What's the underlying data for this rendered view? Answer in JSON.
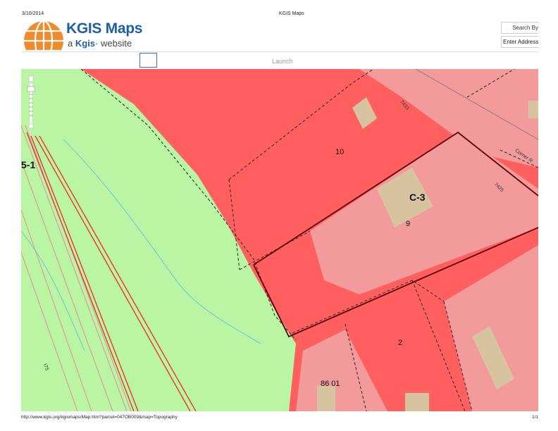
{
  "print_header": {
    "date": "3/10/2014",
    "title": "KGIS Maps"
  },
  "logo": {
    "title": "KGIS Maps",
    "sub_prefix": "a",
    "sub_brand": "Kgis",
    "sub_suffix": "website"
  },
  "search": {
    "by_label": "Search By",
    "address_value": "Enter Address"
  },
  "launch": {
    "label": "Launch"
  },
  "map": {
    "parcels": {
      "p10": "10",
      "p9": "9",
      "p2": "2",
      "p8601": "86 01"
    },
    "zones": {
      "c3": "C-3",
      "a1": "5-1"
    },
    "streets": {
      "s1": "7433",
      "s2": "7425",
      "s3": "Corner R",
      "s4": "I75"
    }
  },
  "colors": {
    "zone_red": "#ff5f5f",
    "parcel_pink": "#f39a9a",
    "zone_green": "#b9f5a3",
    "building": "#d8c3a0",
    "logo_blue": "#1d5fa8",
    "logo_orange": "#f08a2a"
  },
  "print_footer": {
    "url": "http://www.kgis.org/kgismaps/Map.htm?parcel=047OB009&map=Topography",
    "page": "1/1"
  }
}
